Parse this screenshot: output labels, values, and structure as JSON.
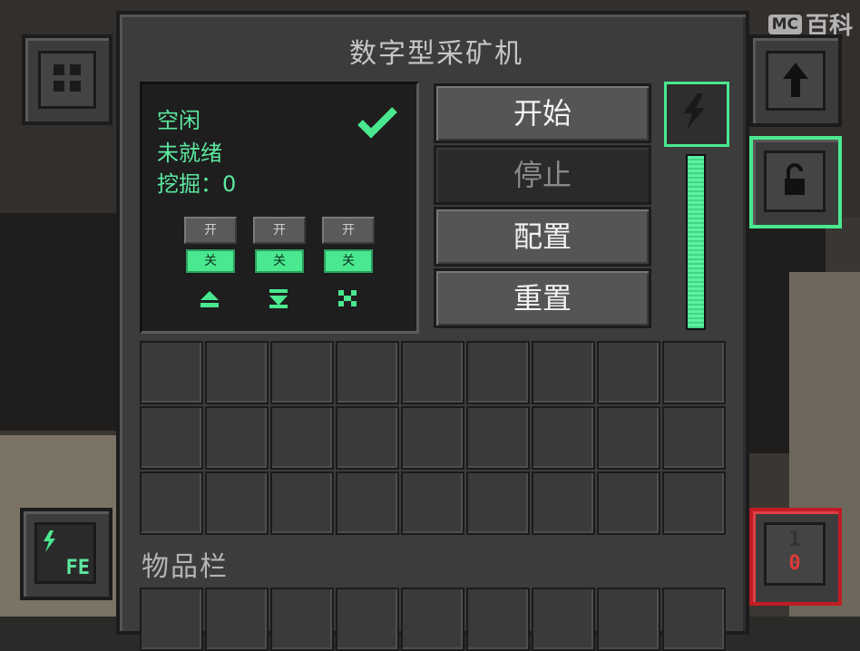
{
  "watermark": {
    "mc": "MC",
    "text": "百科"
  },
  "window": {
    "title": "数字型采矿机"
  },
  "status": {
    "line1": "空闲",
    "line2": "未就绪",
    "line3": "挖掘：0",
    "check_icon": "checkmark-icon"
  },
  "toggles": [
    {
      "on": "开",
      "off": "关",
      "icon": "eject-icon"
    },
    {
      "on": "开",
      "off": "关",
      "icon": "input-icon"
    },
    {
      "on": "开",
      "off": "关",
      "icon": "silk-touch-icon"
    }
  ],
  "buttons": {
    "start": "开始",
    "stop": "停止",
    "config": "配置",
    "reset": "重置"
  },
  "energy": {
    "icon": "lightning-icon",
    "level": 1.0
  },
  "inventory": {
    "label": "物品栏"
  },
  "left_tabs": {
    "menu_icon": "grid-icon",
    "energy_label": "FE"
  },
  "right_tabs": {
    "upgrade_icon": "up-arrow-icon",
    "security_icon": "padlock-open-icon",
    "redstone_top": "1",
    "redstone_bottom": "0"
  },
  "colors": {
    "accent": "#4ae88f",
    "red_tab": "#c11b24"
  }
}
